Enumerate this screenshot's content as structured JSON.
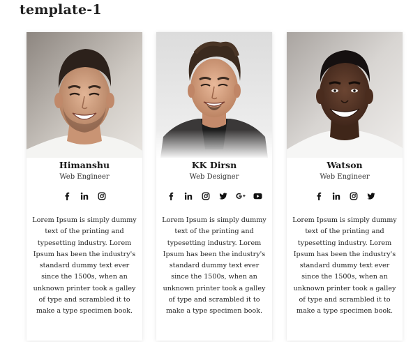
{
  "page": {
    "title": "template-1"
  },
  "colors": {
    "card_bg": "#ffffff",
    "text": "#222222",
    "icon": "#111111"
  },
  "cards": [
    {
      "name": "Himanshu",
      "role": "Web Engineer",
      "socials": [
        "facebook-icon",
        "linkedin-icon",
        "instagram-icon"
      ],
      "description": "Lorem Ipsum is simply dummy text of the printing and typesetting industry. Lorem Ipsum has been the industry's standard dummy text ever since the 1500s, when an unknown printer took a galley of type and scrambled it to make a type specimen book."
    },
    {
      "name": "KK Dirsn",
      "role": "Web Designer",
      "socials": [
        "facebook-icon",
        "linkedin-icon",
        "instagram-icon",
        "twitter-icon",
        "google-plus-icon",
        "youtube-icon"
      ],
      "description": "Lorem Ipsum is simply dummy text of the printing and typesetting industry. Lorem Ipsum has been the industry's standard dummy text ever since the 1500s, when an unknown printer took a galley of type and scrambled it to make a type specimen book."
    },
    {
      "name": "Watson",
      "role": "Web Engineer",
      "socials": [
        "facebook-icon",
        "linkedin-icon",
        "instagram-icon",
        "twitter-icon"
      ],
      "description": "Lorem Ipsum is simply dummy text of the printing and typesetting industry. Lorem Ipsum has been the industry's standard dummy text ever since the 1500s, when an unknown printer took a galley of type and scrambled it to make a type specimen book."
    }
  ]
}
